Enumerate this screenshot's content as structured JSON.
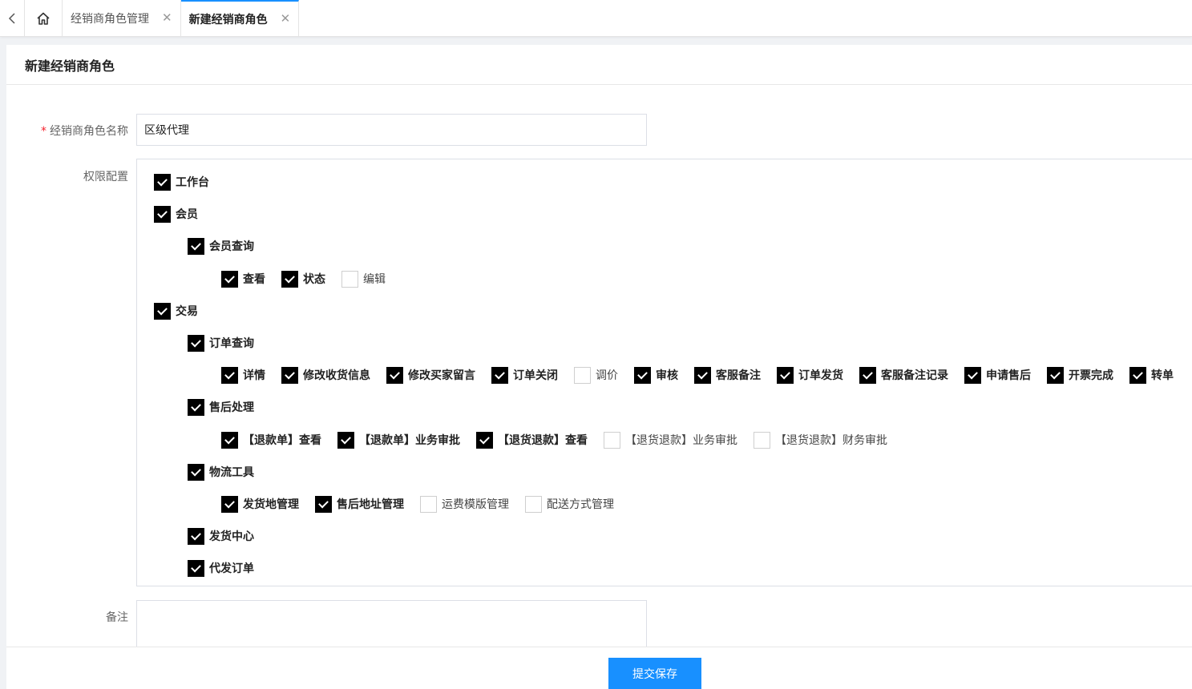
{
  "tabs": {
    "items": [
      {
        "label": "经销商角色管理",
        "active": false
      },
      {
        "label": "新建经销商角色",
        "active": true
      }
    ],
    "close_glyph": "✕"
  },
  "page": {
    "title": "新建经销商角色"
  },
  "form": {
    "name_label": "经销商角色名称",
    "required_mark": "*",
    "name_value": "区级代理",
    "perm_label": "权限配置",
    "remark_label": "备注",
    "submit_label": "提交保存"
  },
  "permissions": [
    {
      "level": 0,
      "items": [
        {
          "label": "工作台",
          "checked": true
        }
      ]
    },
    {
      "level": 0,
      "items": [
        {
          "label": "会员",
          "checked": true
        }
      ]
    },
    {
      "level": 1,
      "items": [
        {
          "label": "会员查询",
          "checked": true
        }
      ]
    },
    {
      "level": 2,
      "items": [
        {
          "label": "查看",
          "checked": true
        },
        {
          "label": "状态",
          "checked": true
        },
        {
          "label": "编辑",
          "checked": false
        }
      ]
    },
    {
      "level": 0,
      "items": [
        {
          "label": "交易",
          "checked": true
        }
      ]
    },
    {
      "level": 1,
      "items": [
        {
          "label": "订单查询",
          "checked": true
        }
      ]
    },
    {
      "level": 2,
      "items": [
        {
          "label": "详情",
          "checked": true
        },
        {
          "label": "修改收货信息",
          "checked": true
        },
        {
          "label": "修改买家留言",
          "checked": true
        },
        {
          "label": "订单关闭",
          "checked": true
        },
        {
          "label": "调价",
          "checked": false
        },
        {
          "label": "审核",
          "checked": true
        },
        {
          "label": "客服备注",
          "checked": true
        },
        {
          "label": "订单发货",
          "checked": true
        },
        {
          "label": "客服备注记录",
          "checked": true
        },
        {
          "label": "申请售后",
          "checked": true
        },
        {
          "label": "开票完成",
          "checked": true
        },
        {
          "label": "转单",
          "checked": true
        }
      ]
    },
    {
      "level": 1,
      "items": [
        {
          "label": "售后处理",
          "checked": true
        }
      ]
    },
    {
      "level": 2,
      "items": [
        {
          "label": "【退款单】查看",
          "checked": true
        },
        {
          "label": "【退款单】业务审批",
          "checked": true
        },
        {
          "label": "【退货退款】查看",
          "checked": true
        },
        {
          "label": "【退货退款】业务审批",
          "checked": false
        },
        {
          "label": "【退货退款】财务审批",
          "checked": false
        }
      ]
    },
    {
      "level": 1,
      "items": [
        {
          "label": "物流工具",
          "checked": true
        }
      ]
    },
    {
      "level": 2,
      "items": [
        {
          "label": "发货地管理",
          "checked": true
        },
        {
          "label": "售后地址管理",
          "checked": true
        },
        {
          "label": "运费模版管理",
          "checked": false
        },
        {
          "label": "配送方式管理",
          "checked": false
        }
      ]
    },
    {
      "level": 1,
      "items": [
        {
          "label": "发货中心",
          "checked": true
        }
      ]
    },
    {
      "level": 1,
      "items": [
        {
          "label": "代发订单",
          "checked": true
        }
      ]
    }
  ]
}
